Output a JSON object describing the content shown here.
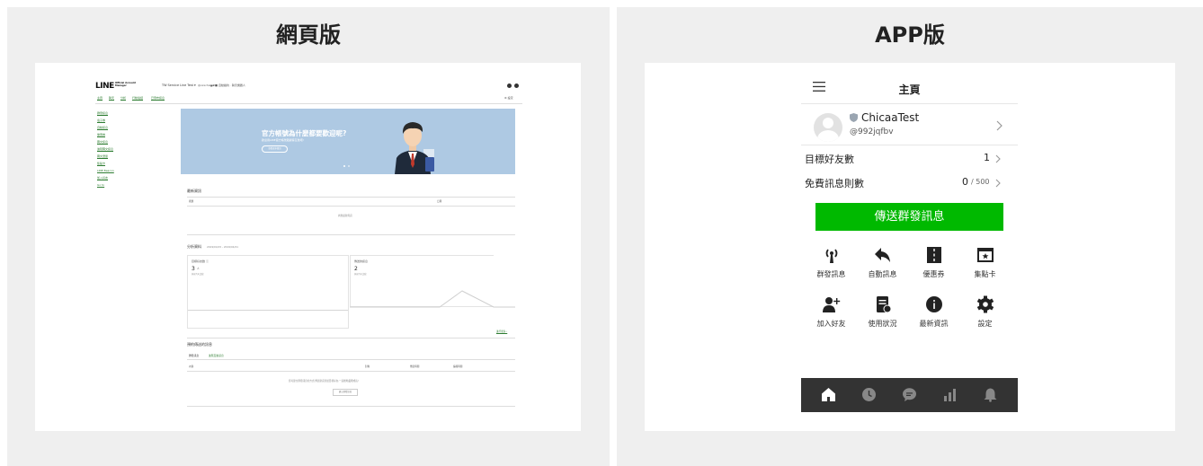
{
  "panels": {
    "left_title": "網頁版",
    "right_title": "APP版"
  },
  "web": {
    "logo": "LINE",
    "logo_sub1": "Official Account",
    "logo_sub2": "Manager",
    "account": "TW Service Line Test ▾",
    "account_id": "@xxxchatest",
    "header_extra": "▲2 ■ 自動續約 · 聊天機器人",
    "nav": [
      "主頁",
      "聊天",
      "分析",
      "行動電話",
      "已發布訊息"
    ],
    "settings": "⚙ 設定",
    "sidebar": [
      "群發訊息",
      "電子券",
      "自動訊息",
      "優惠券",
      "圖文訊息",
      "進階圖文訊息",
      "圖文選單",
      "集點卡",
      "LINE Beacon",
      "加入好友",
      "Go to"
    ],
    "banner": {
      "headline": "官方帳號為什麼都要歡迎呢?",
      "sub": "歡迎用LINE官方帳號跟顧客互動吧!",
      "button": "查看更多資訊"
    },
    "news": {
      "title": "最新資訊",
      "col_title": "標題",
      "col_date": "日期",
      "empty": "尚無最新資訊"
    },
    "analytics": {
      "title": "分析資料",
      "range": "2019/04/15 - 2019/04/21",
      "friends_label": "目標好友數 ⓘ",
      "friends_value": "3",
      "friends_unit": "人",
      "friends_note": "與前7天比較",
      "msgs_label": "傳送的訊息",
      "msgs_value": "2",
      "msgs_note": "與前7天比較",
      "more_link": "進行更多 ›"
    },
    "scheduled": {
      "title": "預約傳送的訊息",
      "tab1": "群發訊息",
      "tab2": "進階互動訊息",
      "cols": [
        "內容",
        "對象",
        "傳送時間",
        "編輯時間"
      ],
      "empty": "您可建立群發訊息的方式,傳送新訊息給目標好友,一起推動業務成長!",
      "button": "建立群發訊息"
    }
  },
  "app": {
    "title": "主頁",
    "account_name": "ChicaaTest",
    "account_id": "@992jqfbv",
    "friends_label": "目標好友數",
    "friends_value": "1",
    "free_label": "免費訊息則數",
    "free_used": "0",
    "free_total": "/ 500",
    "send_button": "傳送群發訊息",
    "icons_row1": [
      "群發訊息",
      "自動訊息",
      "優惠券",
      "集點卡"
    ],
    "icons_row2": [
      "加入好友",
      "使用狀況",
      "最新資訊",
      "設定"
    ],
    "tabbar": [
      "home-icon",
      "clock-icon",
      "chat-icon",
      "chart-icon",
      "bell-icon"
    ],
    "accent_color": "#00b900"
  }
}
